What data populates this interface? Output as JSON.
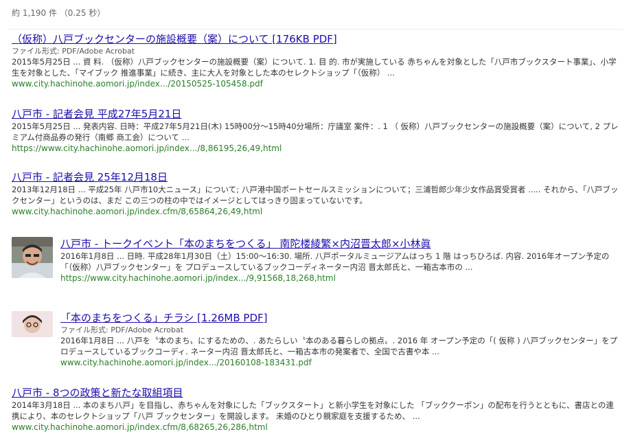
{
  "stats": "約 1,190 件 （0.25 秒）",
  "results": [
    {
      "title": "（仮称）八戸ブックセンターの施設概要（案）について [176KB PDF]",
      "filetype": "ファイル形式: PDF/Adobe Acrobat",
      "snippet": "2015年5月25日 ... 資 料. （仮称）八戸ブックセンターの施設概要（案）について. 1. 目 的. 市が実施している 赤ちゃんを対象とした「八戸市ブックスタート事業」、小学生を対象とした、「マイブック 推進事業」に続き、主に大人を対象とした本のセレクトショップ「（仮称） ...",
      "url": "www.city.hachinohe.aomori.jp/index.../20150525-105458.pdf"
    },
    {
      "title": "八戸市 - 記者会見 平成27年5月21日",
      "snippet": "2015年5月25日 ... 発表内容. 日時：平成27年5月21日(木) 15時00分〜15時40分場所：庁議室 案件：. 1 （ 仮称）八戸ブックセンターの施設概要（案）について, 2 プレミアム付商品券の発行（南郷 商工会）について ...",
      "url": "https://www.city.hachinohe.aomori.jp/index.../8,86195,26,49,html"
    },
    {
      "title": "八戸市 - 記者会見 25年12月18日",
      "snippet": "2013年12月18日 ... 平成25年 八戸市10大ニュース」について; 八戸港中国ポートセールスミッションについて；三浦哲郎少年少女作品賞受賞者 ..... それから、「八戸ブックセンター」というのは、まだ この三つの柱の中ではイメージとしてはっきり固まっていないです。",
      "url": "www.city.hachinohe.aomori.jp/index.cfm/8,65864,26,49,html"
    },
    {
      "title": "八戸市 - トークイベント「本のまちをつくる」 南陀楼綾繁×内沼晋太郎×小林眞",
      "snippet": "2016年1月8日 ... 日時. 平成28年1月30日（土）15:00〜16:30. 場所. 八戸ポータルミュージアムはっち 1 階 はっちひろば. 内容. 2016年オープン予定の「（仮称）八戸ブックセンター」を プロデュースしているブックコーディネーター内沼 晋太郎氏と、一箱古本市の ...",
      "url": "https://www.city.hachinohe.aomori.jp/index.../9,91568,18,268,html"
    },
    {
      "title": "「本のまちをつくる」チラシ [1.26MB PDF]",
      "filetype": "ファイル形式: PDF/Adobe Acrobat",
      "snippet": "2016年1月8日 ... 八戸を〝本のまち〟にするための、. あたらしい〝本のある暮らしの拠点〟. 2016 年 オープン予定の「( 仮称 ) 八戸ブックセンター」をプロデュースしているブックコーディ. ネーター内沼 晋太郎氏と、一箱古本市の発案者で、全国で古書や本 ...",
      "url": "www.city.hachinohe.aomori.jp/index.../20160108-183431.pdf"
    },
    {
      "title": "八戸市 - 8つの政策と新たな取組項目",
      "snippet": "2014年3月18日 ... 本のまち八戸」を目指し、赤ちゃんを対象にした「ブックスタート」と新小学生を対象にした 「ブッククーポン」の配布を行うとともに、書店との連携により、本のセレクトショップ「八戸 ブックセンター」を開設します。 未婚のひとり親家庭を支援するため、 ...",
      "url": "www.city.hachinohe.aomori.jp/index.cfm/8,68265,26,286,html"
    }
  ]
}
